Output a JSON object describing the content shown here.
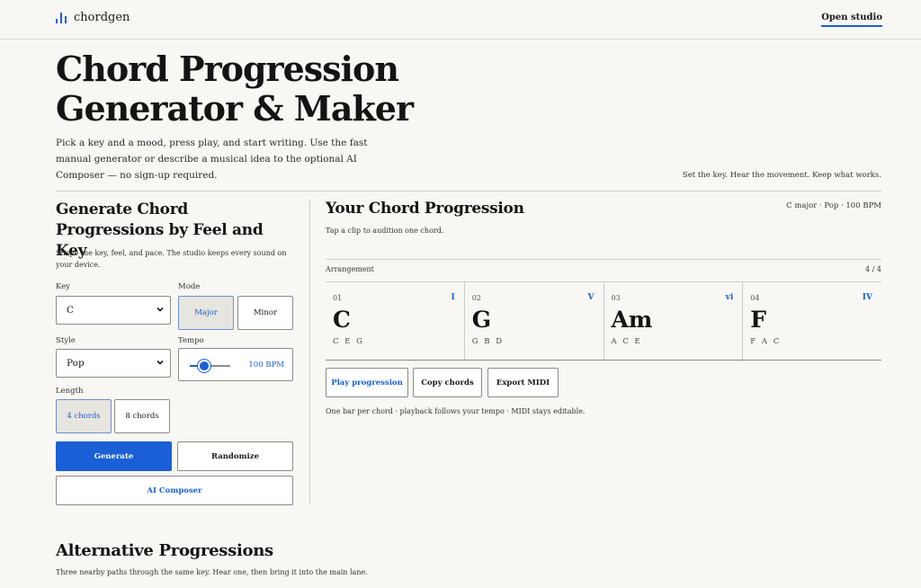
{
  "header": {
    "brand": "chordgen",
    "brand_icon": "bar-chart-icon",
    "open_studio": "Open studio"
  },
  "hero": {
    "title_line1": "Chord Progression",
    "title_line2": "Generator & Maker",
    "description": "Pick a key and a mood, press play, and start writing. Use the fast manual generator or describe a musical idea to the optional AI Composer — no sign-up required.",
    "tagline": "Set the key. Hear the movement. Keep what works."
  },
  "generator": {
    "title": "Generate Chord Progressions by Feel and Key",
    "description": "Shape the key, feel, and pace. The studio keeps every sound on your device.",
    "key_label": "Key",
    "key_value": "C",
    "mode_label": "Mode",
    "mode_options": [
      "Major",
      "Minor"
    ],
    "mode_selected": "Major",
    "style_label": "Style",
    "style_value": "Pop",
    "tempo_label": "Tempo",
    "tempo_value": "100 BPM",
    "tempo_level": 0.35,
    "length_label": "Length",
    "length_options": [
      "4 chords",
      "8 chords"
    ],
    "length_selected": "4 chords",
    "generate": "Generate",
    "randomize": "Randomize",
    "ai_composer": "AI Composer"
  },
  "progression": {
    "title": "Your Chord Progression",
    "meta": "C major · Pop · 100 BPM",
    "hint": "Tap a clip to audition one chord.",
    "arrangement_label": "Arrangement",
    "arrangement_count": "4 / 4",
    "chords": [
      {
        "num": "01",
        "roman": "I",
        "name": "C",
        "notes": "C E G"
      },
      {
        "num": "02",
        "roman": "V",
        "name": "G",
        "notes": "G B D"
      },
      {
        "num": "03",
        "roman": "vi",
        "name": "Am",
        "notes": "A C E"
      },
      {
        "num": "04",
        "roman": "IV",
        "name": "F",
        "notes": "F A C"
      }
    ],
    "play": "Play progression",
    "copy": "Copy chords",
    "export": "Export MIDI",
    "footnote": "One bar per chord · playback follows your tempo · MIDI stays editable."
  },
  "alternatives": {
    "title": "Alternative Progressions",
    "description": "Three nearby paths through the same key. Hear one, then bring it into the main lane."
  },
  "colors": {
    "accent": "#1a5fd6",
    "background": "#f8f7f4"
  }
}
